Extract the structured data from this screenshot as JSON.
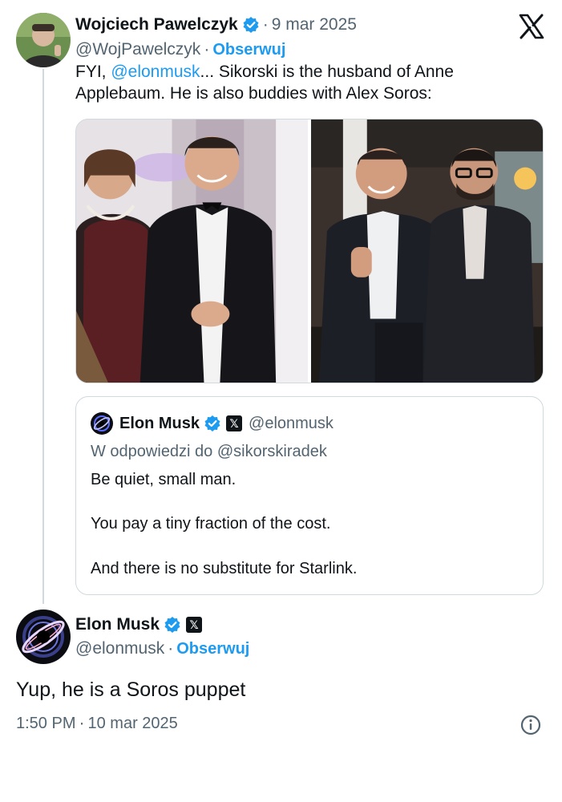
{
  "parent": {
    "name": "Wojciech Pawelczyk",
    "date": "9 mar 2025",
    "handle": "@WojPawelczyk",
    "follow": "Obserwuj",
    "text_prefix": "FYI, ",
    "mention": "@elonmusk",
    "text_suffix": "... Sikorski is the husband of Anne Applebaum. He is also buddies with Alex Soros:"
  },
  "quote": {
    "name": "Elon Musk",
    "handle": "@elonmusk",
    "reply_to": "W odpowiedzi do @sikorskiradek",
    "line1": "Be quiet, small man.",
    "line2": "You pay a tiny fraction of the cost.",
    "line3": "And there is no substitute for Starlink."
  },
  "main": {
    "name": "Elon Musk",
    "handle": "@elonmusk",
    "follow": "Obserwuj",
    "text": "Yup, he is a Soros puppet",
    "time": "1:50 PM",
    "date": "10 mar 2025"
  },
  "separator": "·",
  "colors": {
    "accent": "#1d9bf0",
    "muted": "#536471",
    "text": "#0f1419",
    "border": "#cfd9de"
  },
  "icons": {
    "platform": "x-logo-icon",
    "verified": "verified-badge-icon",
    "affiliate": "x-affiliate-badge-icon",
    "info": "info-icon"
  }
}
